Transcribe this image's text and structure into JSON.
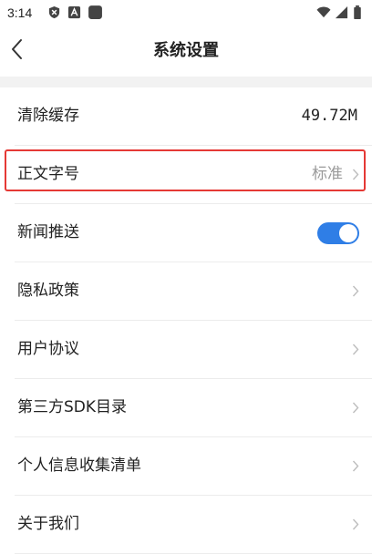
{
  "status_bar": {
    "time": "3:14",
    "icons": [
      "shield-icon",
      "font-icon",
      "app-square-icon",
      "wifi-icon",
      "signal-icon",
      "battery-icon"
    ]
  },
  "header": {
    "title": "系统设置",
    "back_icon": "chevron-left-icon"
  },
  "settings": {
    "items": [
      {
        "label": "清除缓存",
        "value": "49.72M"
      },
      {
        "label": "正文字号",
        "value": "标准"
      },
      {
        "label": "新闻推送",
        "toggle_on": true
      },
      {
        "label": "隐私政策"
      },
      {
        "label": "用户协议"
      },
      {
        "label": "第三方SDK目录"
      },
      {
        "label": "个人信息收集清单"
      },
      {
        "label": "关于我们"
      }
    ]
  },
  "colors": {
    "accent": "#2f7ee6",
    "highlight": "#e53935",
    "muted_text": "#9a9a9a",
    "band": "#f2f2f2"
  }
}
